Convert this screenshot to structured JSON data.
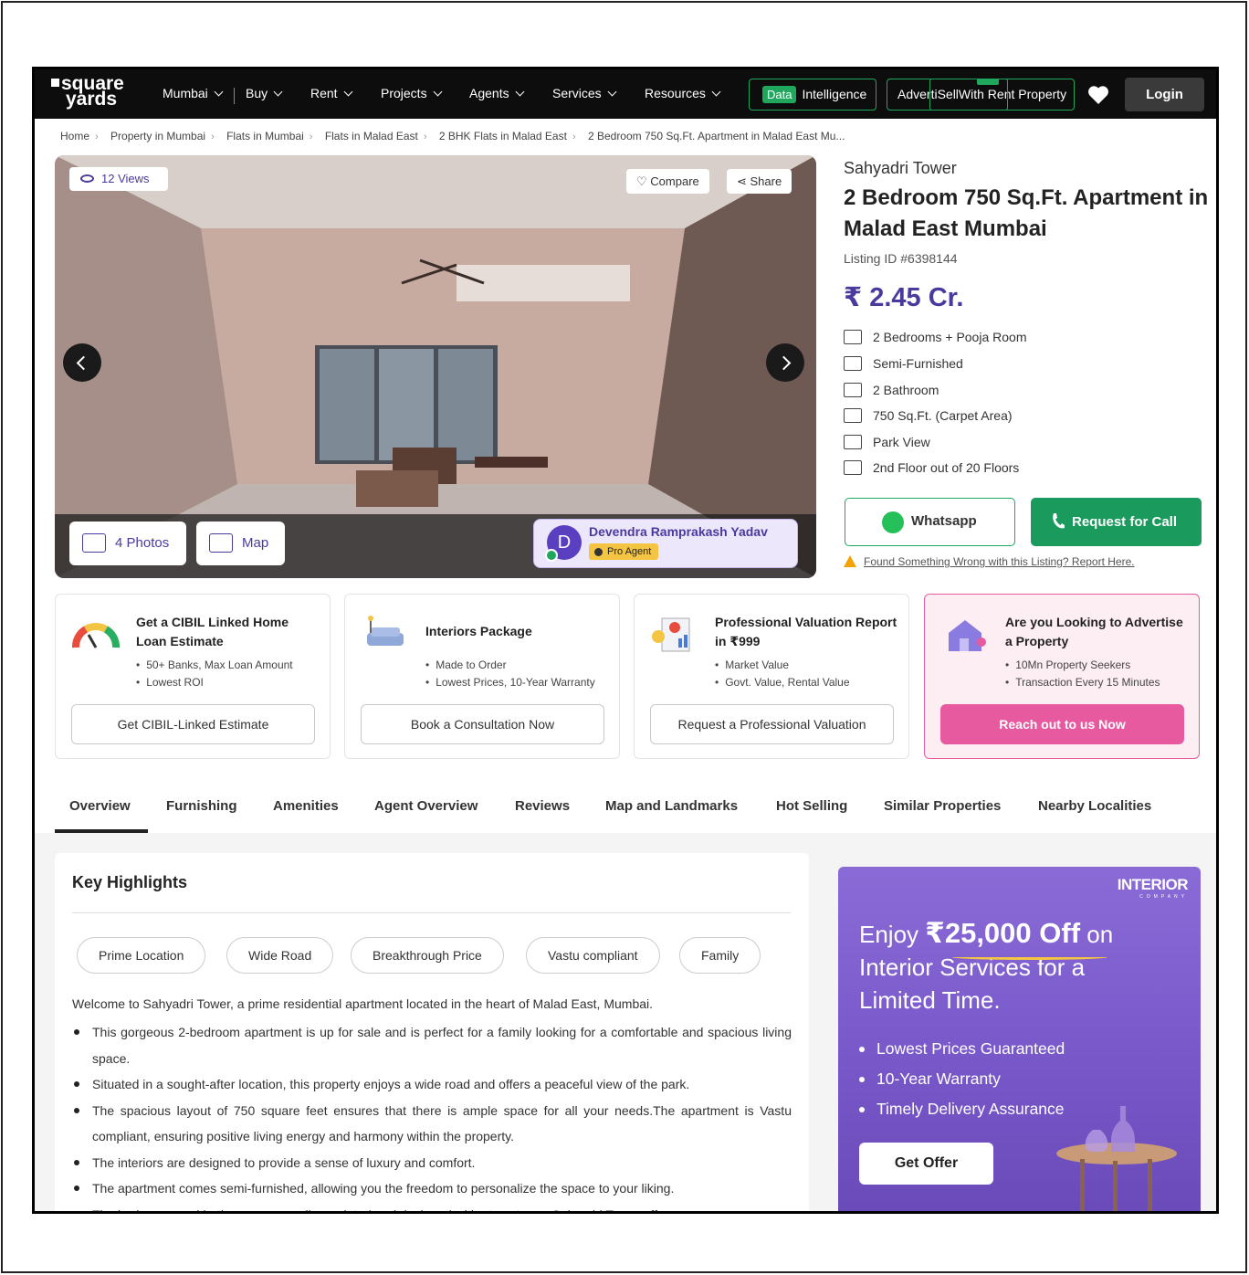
{
  "header": {
    "logo_line1": "square",
    "logo_line2": "yards",
    "city": "Mumbai",
    "nav": [
      "Buy",
      "Rent",
      "Projects",
      "Agents",
      "Services",
      "Resources"
    ],
    "data_tag": "Data",
    "data_label": "Intelligence",
    "advertise_label": "AdvertiSellWith Rent Property",
    "login": "Login"
  },
  "breadcrumb": [
    "Home",
    "Property in Mumbai",
    "Flats in Mumbai",
    "Flats in Malad East",
    "2 BHK Flats in Malad East",
    "2 Bedroom 750 Sq.Ft. Apartment in Malad East Mu..."
  ],
  "gallery": {
    "views": "12 Views",
    "compare": "Compare",
    "share": "Share",
    "photos": "4 Photos",
    "map": "Map",
    "agent_initial": "D",
    "agent_name": "Devendra Ramprakash Yadav",
    "agent_badge": "Pro Agent"
  },
  "property": {
    "tower": "Sahyadri Tower",
    "title": "2 Bedroom 750 Sq.Ft. Apartment in Malad East Mumbai",
    "listing_id": "Listing ID #6398144",
    "price": "₹ 2.45 Cr.",
    "features": [
      {
        "icon": "bed-icon",
        "text": "2 Bedrooms + Pooja Room"
      },
      {
        "icon": "sofa-icon",
        "text": "Semi-Furnished"
      },
      {
        "icon": "bathtub-icon",
        "text": "2 Bathroom"
      },
      {
        "icon": "area-icon",
        "text": "750 Sq.Ft. (Carpet Area)"
      },
      {
        "icon": "park-view-icon",
        "text": "Park View"
      },
      {
        "icon": "floor-icon",
        "text": "2nd Floor out of 20 Floors"
      }
    ],
    "whatsapp": "Whatsapp",
    "request_call": "Request for Call",
    "report": "Found Something Wrong with this Listing? Report Here."
  },
  "services": [
    {
      "title": "Get a CIBIL Linked Home Loan Estimate",
      "b1": "50+ Banks, Max Loan Amount",
      "b2": "Lowest ROI",
      "button": "Get CIBIL-Linked Estimate"
    },
    {
      "title": "Interiors Package",
      "b1": "Made to Order",
      "b2": "Lowest Prices, 10-Year Warranty",
      "button": "Book a Consultation Now"
    },
    {
      "title": "Professional Valuation Report in ₹999",
      "b1": "Market Value",
      "b2": "Govt. Value, Rental Value",
      "button": "Request a Professional Valuation"
    },
    {
      "title": "Are you Looking to Advertise a Property",
      "b1": "10Mn Property Seekers",
      "b2": "Transaction Every 15 Minutes",
      "button": "Reach out to us Now"
    }
  ],
  "tabs": [
    "Overview",
    "Furnishing",
    "Amenities",
    "Agent Overview",
    "Reviews",
    "Map and Landmarks",
    "Hot Selling",
    "Similar Properties",
    "Nearby Localities"
  ],
  "highlights": {
    "title": "Key Highlights",
    "chips": [
      "Prime Location",
      "Wide Road",
      "Breakthrough Price",
      "Vastu compliant",
      "Family"
    ],
    "intro": "Welcome to Sahyadri Tower, a prime residential apartment located in the heart of Malad East, Mumbai.",
    "points": [
      "This gorgeous 2-bedroom apartment is up for sale and is perfect for a family looking for a comfortable and spacious living space.",
      "Situated in a sought-after location, this property enjoys a wide road and offers a peaceful view of the park.",
      "The spacious layout of 750 square feet ensures that there is ample space for all your needs.The apartment is Vastu compliant, ensuring positive living energy and harmony within the property.",
      "The interiors are designed to provide a sense of luxury and comfort.",
      "The apartment comes semi-furnished, allowing you the freedom to personalize the space to your liking.",
      "The bedrooms and bathrooms are well-appointed and designed with utmost care.Sahyadri Tower offers a range"
    ]
  },
  "ad": {
    "brand": "INTERIOR",
    "brand_sub": "COMPANY",
    "head_pre": "Enjoy ",
    "head_amount": "₹25,000 Off",
    "head_post": " on Interior Services for a Limited Time.",
    "bullets": [
      "Lowest Prices Guaranteed",
      "10-Year Warranty",
      "Timely Delivery Assurance"
    ],
    "button": "Get Offer"
  },
  "colors": {
    "brand_purple": "#4b3a9e",
    "green": "#1a9a5c",
    "pink": "#e75aa0"
  }
}
